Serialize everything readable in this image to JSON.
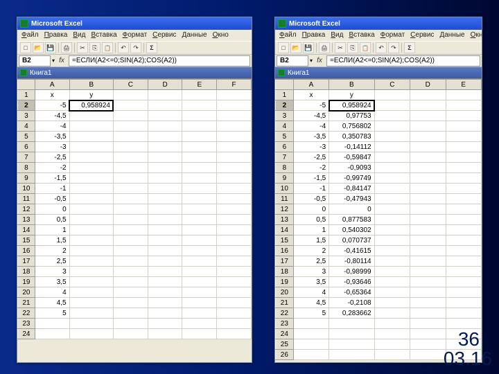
{
  "footer": {
    "page": "36",
    "date": "03.16"
  },
  "app_title": "Microsoft Excel",
  "menu": [
    "Файл",
    "Правка",
    "Вид",
    "Вставка",
    "Формат",
    "Сервис",
    "Данные",
    "Окно"
  ],
  "left": {
    "namebox": "B2",
    "formula": "=ЕСЛИ(A2<=0;SIN(A2);COS(A2))",
    "workbook": "Книга1",
    "cols": [
      "A",
      "B",
      "C",
      "D",
      "E",
      "F"
    ],
    "headers": {
      "A": "x",
      "B": "y"
    },
    "sel_row": 2,
    "sel_col": 2,
    "rows": [
      {
        "r": 1,
        "a": "x",
        "b": "y",
        "hdr": true
      },
      {
        "r": 2,
        "a": "-5",
        "b": "0,958924"
      },
      {
        "r": 3,
        "a": "-4,5",
        "b": ""
      },
      {
        "r": 4,
        "a": "-4",
        "b": ""
      },
      {
        "r": 5,
        "a": "-3,5",
        "b": ""
      },
      {
        "r": 6,
        "a": "-3",
        "b": ""
      },
      {
        "r": 7,
        "a": "-2,5",
        "b": ""
      },
      {
        "r": 8,
        "a": "-2",
        "b": ""
      },
      {
        "r": 9,
        "a": "-1,5",
        "b": ""
      },
      {
        "r": 10,
        "a": "-1",
        "b": ""
      },
      {
        "r": 11,
        "a": "-0,5",
        "b": ""
      },
      {
        "r": 12,
        "a": "0",
        "b": ""
      },
      {
        "r": 13,
        "a": "0,5",
        "b": ""
      },
      {
        "r": 14,
        "a": "1",
        "b": ""
      },
      {
        "r": 15,
        "a": "1,5",
        "b": ""
      },
      {
        "r": 16,
        "a": "2",
        "b": ""
      },
      {
        "r": 17,
        "a": "2,5",
        "b": ""
      },
      {
        "r": 18,
        "a": "3",
        "b": ""
      },
      {
        "r": 19,
        "a": "3,5",
        "b": ""
      },
      {
        "r": 20,
        "a": "4",
        "b": ""
      },
      {
        "r": 21,
        "a": "4,5",
        "b": ""
      },
      {
        "r": 22,
        "a": "5",
        "b": ""
      },
      {
        "r": 23,
        "a": "",
        "b": ""
      },
      {
        "r": 24,
        "a": "",
        "b": ""
      }
    ]
  },
  "right": {
    "namebox": "B2",
    "formula": "=ЕСЛИ(A2<=0;SIN(A2);COS(A2))",
    "workbook": "Книга1",
    "cols": [
      "A",
      "B",
      "C",
      "D",
      "E"
    ],
    "headers": {
      "A": "x",
      "B": "y"
    },
    "sel_row": 2,
    "sel_col": 2,
    "rows": [
      {
        "r": 1,
        "a": "x",
        "b": "y",
        "hdr": true
      },
      {
        "r": 2,
        "a": "-5",
        "b": "0,958924"
      },
      {
        "r": 3,
        "a": "-4,5",
        "b": "0,97753"
      },
      {
        "r": 4,
        "a": "-4",
        "b": "0,756802"
      },
      {
        "r": 5,
        "a": "-3,5",
        "b": "0,350783"
      },
      {
        "r": 6,
        "a": "-3",
        "b": "-0,14112"
      },
      {
        "r": 7,
        "a": "-2,5",
        "b": "-0,59847"
      },
      {
        "r": 8,
        "a": "-2",
        "b": "-0,9093"
      },
      {
        "r": 9,
        "a": "-1,5",
        "b": "-0,99749"
      },
      {
        "r": 10,
        "a": "-1",
        "b": "-0,84147"
      },
      {
        "r": 11,
        "a": "-0,5",
        "b": "-0,47943"
      },
      {
        "r": 12,
        "a": "0",
        "b": "0"
      },
      {
        "r": 13,
        "a": "0,5",
        "b": "0,877583"
      },
      {
        "r": 14,
        "a": "1",
        "b": "0,540302"
      },
      {
        "r": 15,
        "a": "1,5",
        "b": "0,070737"
      },
      {
        "r": 16,
        "a": "2",
        "b": "-0,41615"
      },
      {
        "r": 17,
        "a": "2,5",
        "b": "-0,80114"
      },
      {
        "r": 18,
        "a": "3",
        "b": "-0,98999"
      },
      {
        "r": 19,
        "a": "3,5",
        "b": "-0,93646"
      },
      {
        "r": 20,
        "a": "4",
        "b": "-0,65364"
      },
      {
        "r": 21,
        "a": "4,5",
        "b": "-0,2108"
      },
      {
        "r": 22,
        "a": "5",
        "b": "0,283662"
      },
      {
        "r": 23,
        "a": "",
        "b": ""
      },
      {
        "r": 24,
        "a": "",
        "b": ""
      },
      {
        "r": 25,
        "a": "",
        "b": ""
      },
      {
        "r": 26,
        "a": "",
        "b": ""
      }
    ]
  }
}
